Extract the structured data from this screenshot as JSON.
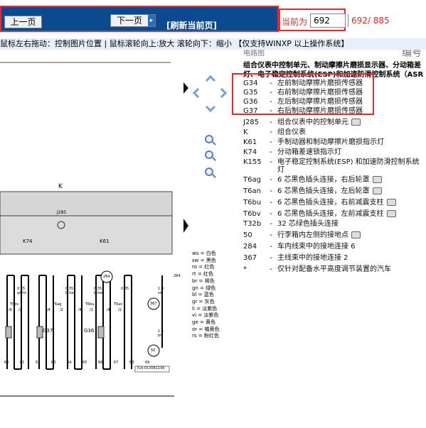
{
  "toolbar": {
    "prev_label": "上一页",
    "next_label": "下一页",
    "refresh_label": "[刷新当前页]",
    "current_label": "当前为",
    "page_value": "692",
    "page_count": "692/ 885"
  },
  "hint": {
    "text": "鼠标左右拖动：控制图片位置 | 鼠标滚轮向上:放大  滚轮向下：缩小 【仅支持WINXP 以上操作系统】"
  },
  "document": {
    "top_left_label": "电路图",
    "top_right_label": "编号",
    "intro_line1": "组合仪表中控制单元、制动摩擦片磨损显示器、分动箱差",
    "intro_line2": "灯、电子稳定控制系统(ESP)和加速防滑控制系统（ASR",
    "items": [
      {
        "code": "G34",
        "desc": "左前制动摩擦片磨损传感器",
        "cam": false
      },
      {
        "code": "G35",
        "desc": "右前制动摩擦片磨损传感器",
        "cam": false
      },
      {
        "code": "G36",
        "desc": "左后制动摩擦片磨损传感器",
        "cam": false
      },
      {
        "code": "G37",
        "desc": "右后制动摩擦片磨损传感器",
        "cam": false
      },
      {
        "code": "J285",
        "desc": "组合仪表中的控制单元",
        "cam": true
      },
      {
        "code": "K",
        "desc": "组合仪表",
        "cam": false
      },
      {
        "code": "K61",
        "desc": "手制动器和制动摩擦片磨损指示灯",
        "cam": false
      },
      {
        "code": "K74",
        "desc": "分动箱差速锁指示灯",
        "cam": false
      },
      {
        "code": "K155",
        "desc": "电子稳定控制系统(ESP) 和加速防滑控制系统",
        "cam": false
      },
      {
        "code": "",
        "desc": "灯",
        "cam": false
      },
      {
        "code": "T6ag",
        "desc": "6 芯黑色插头连接，右后轮罩",
        "cam": true
      },
      {
        "code": "T6an",
        "desc": "6 芯黑色插头连接，左后轮罩",
        "cam": true
      },
      {
        "code": "T6bu",
        "desc": "6 芯黑色插头连接，右前减震支柱",
        "cam": true
      },
      {
        "code": "T6bv",
        "desc": "6 芯黑色插头连接，左前减震支柱",
        "cam": true
      },
      {
        "code": "T32b",
        "desc": "32 芯绿色插头连接",
        "cam": false
      },
      {
        "code": "50",
        "desc": "行李箱内左侧的接地点",
        "cam": true
      },
      {
        "code": "284",
        "desc": "车内线束中的接地连接 6",
        "cam": false
      },
      {
        "code": "367",
        "desc": "主线束中的接地连接 2",
        "cam": false
      },
      {
        "code": "*",
        "desc": "仅针对配备水平高度调节装置的汽车",
        "cam": false
      }
    ],
    "colors": [
      "ws = 白色",
      "sw = 黑色",
      "ro = 红色",
      "rt = 红色",
      "br = 褐色",
      "gn = 绿色",
      "bl = 蓝色",
      "gr = 灰色",
      "li = 淡紫色",
      "vi = 淡紫色",
      "ge = 黄色",
      "or = 橘黄色",
      "rs = 粉红色"
    ],
    "diagram": {
      "k_label": "K",
      "j285_label": "J285",
      "k74_label": "K74",
      "k61_label": "K61",
      "g37_label": "G37",
      "g36_label": "G36",
      "t6bv_label": "T6bv",
      "t6ag_label": "T6ag",
      "t6bu_label": "T6bu",
      "t6an_label": "T6an",
      "wire_035_a": "0.35",
      "wire_035_b": "0.35",
      "wire_035_c": "0.35",
      "wire_035_d": "0.35",
      "wire_10": "1.0",
      "wire_15": "1.5",
      "wire_color_a": "ge/ro",
      "wire_color_b": "bl/sw",
      "wire_color_c": "bl/sw",
      "wire_color_d": "sw",
      "wire_color_e": "br",
      "ground_284": "284",
      "ground_367": "367",
      "ground_50": "50",
      "ground_284_top": "284",
      "pin_a": "/4",
      "pin_b": "/2",
      "pin_c": "/4",
      "pin_d": "/2",
      "pin_e": "/4",
      "pin_f": "/1",
      "pin_g": "/4",
      "pin_h": "/2",
      "cols": [
        "60",
        "61",
        "62",
        "63",
        "64",
        "65",
        "66",
        "67",
        "68",
        "69"
      ],
      "ref_code": "7L6-013061106"
    }
  }
}
